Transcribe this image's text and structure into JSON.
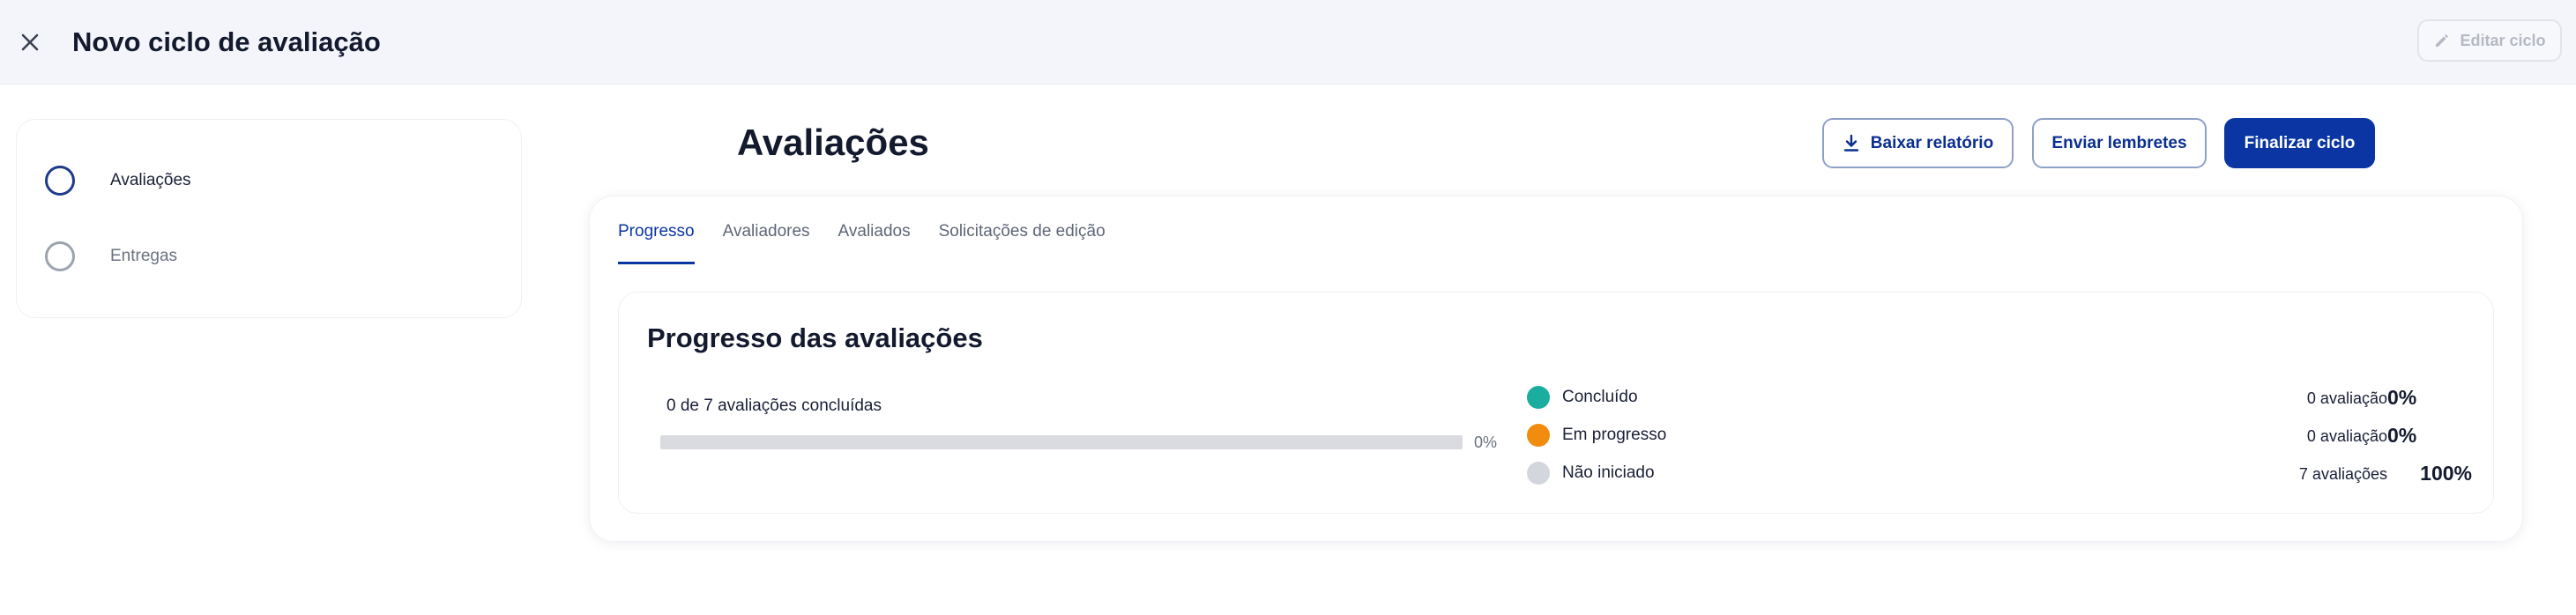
{
  "header": {
    "title": "Novo ciclo de avaliação",
    "edit_label": "Editar ciclo"
  },
  "sidebar": {
    "steps": [
      {
        "label": "Avaliações",
        "active": true
      },
      {
        "label": "Entregas",
        "active": false
      }
    ]
  },
  "main": {
    "title": "Avaliações",
    "actions": {
      "download_label": "Baixar relatório",
      "reminders_label": "Enviar lembretes",
      "finish_label": "Finalizar ciclo"
    },
    "tabs": [
      {
        "label": "Progresso",
        "active": true
      },
      {
        "label": "Avaliadores",
        "active": false
      },
      {
        "label": "Avaliados",
        "active": false
      },
      {
        "label": "Solicitações de edição",
        "active": false
      }
    ],
    "progress": {
      "title": "Progresso das avaliações",
      "summary": "0 de 7 avaliações concluídas",
      "completed_fraction": 0,
      "percent_label": "0%",
      "legend": [
        {
          "name": "Concluído",
          "color": "#1bae9f",
          "count": "0 avaliação",
          "percent": "0%"
        },
        {
          "name": "Em progresso",
          "color": "#f28c0f",
          "count": "0 avaliação",
          "percent": "0%"
        },
        {
          "name": "Não iniciado",
          "color": "#d3d6dc",
          "count": "7 avaliações",
          "percent": "100%"
        }
      ]
    }
  },
  "colors": {
    "primary": "#0a35a3",
    "completed": "#1bae9f",
    "in_progress": "#f28c0f",
    "not_started": "#d3d6dc"
  },
  "icons": {
    "close": "close-icon",
    "edit": "pencil-icon",
    "download": "download-icon"
  }
}
